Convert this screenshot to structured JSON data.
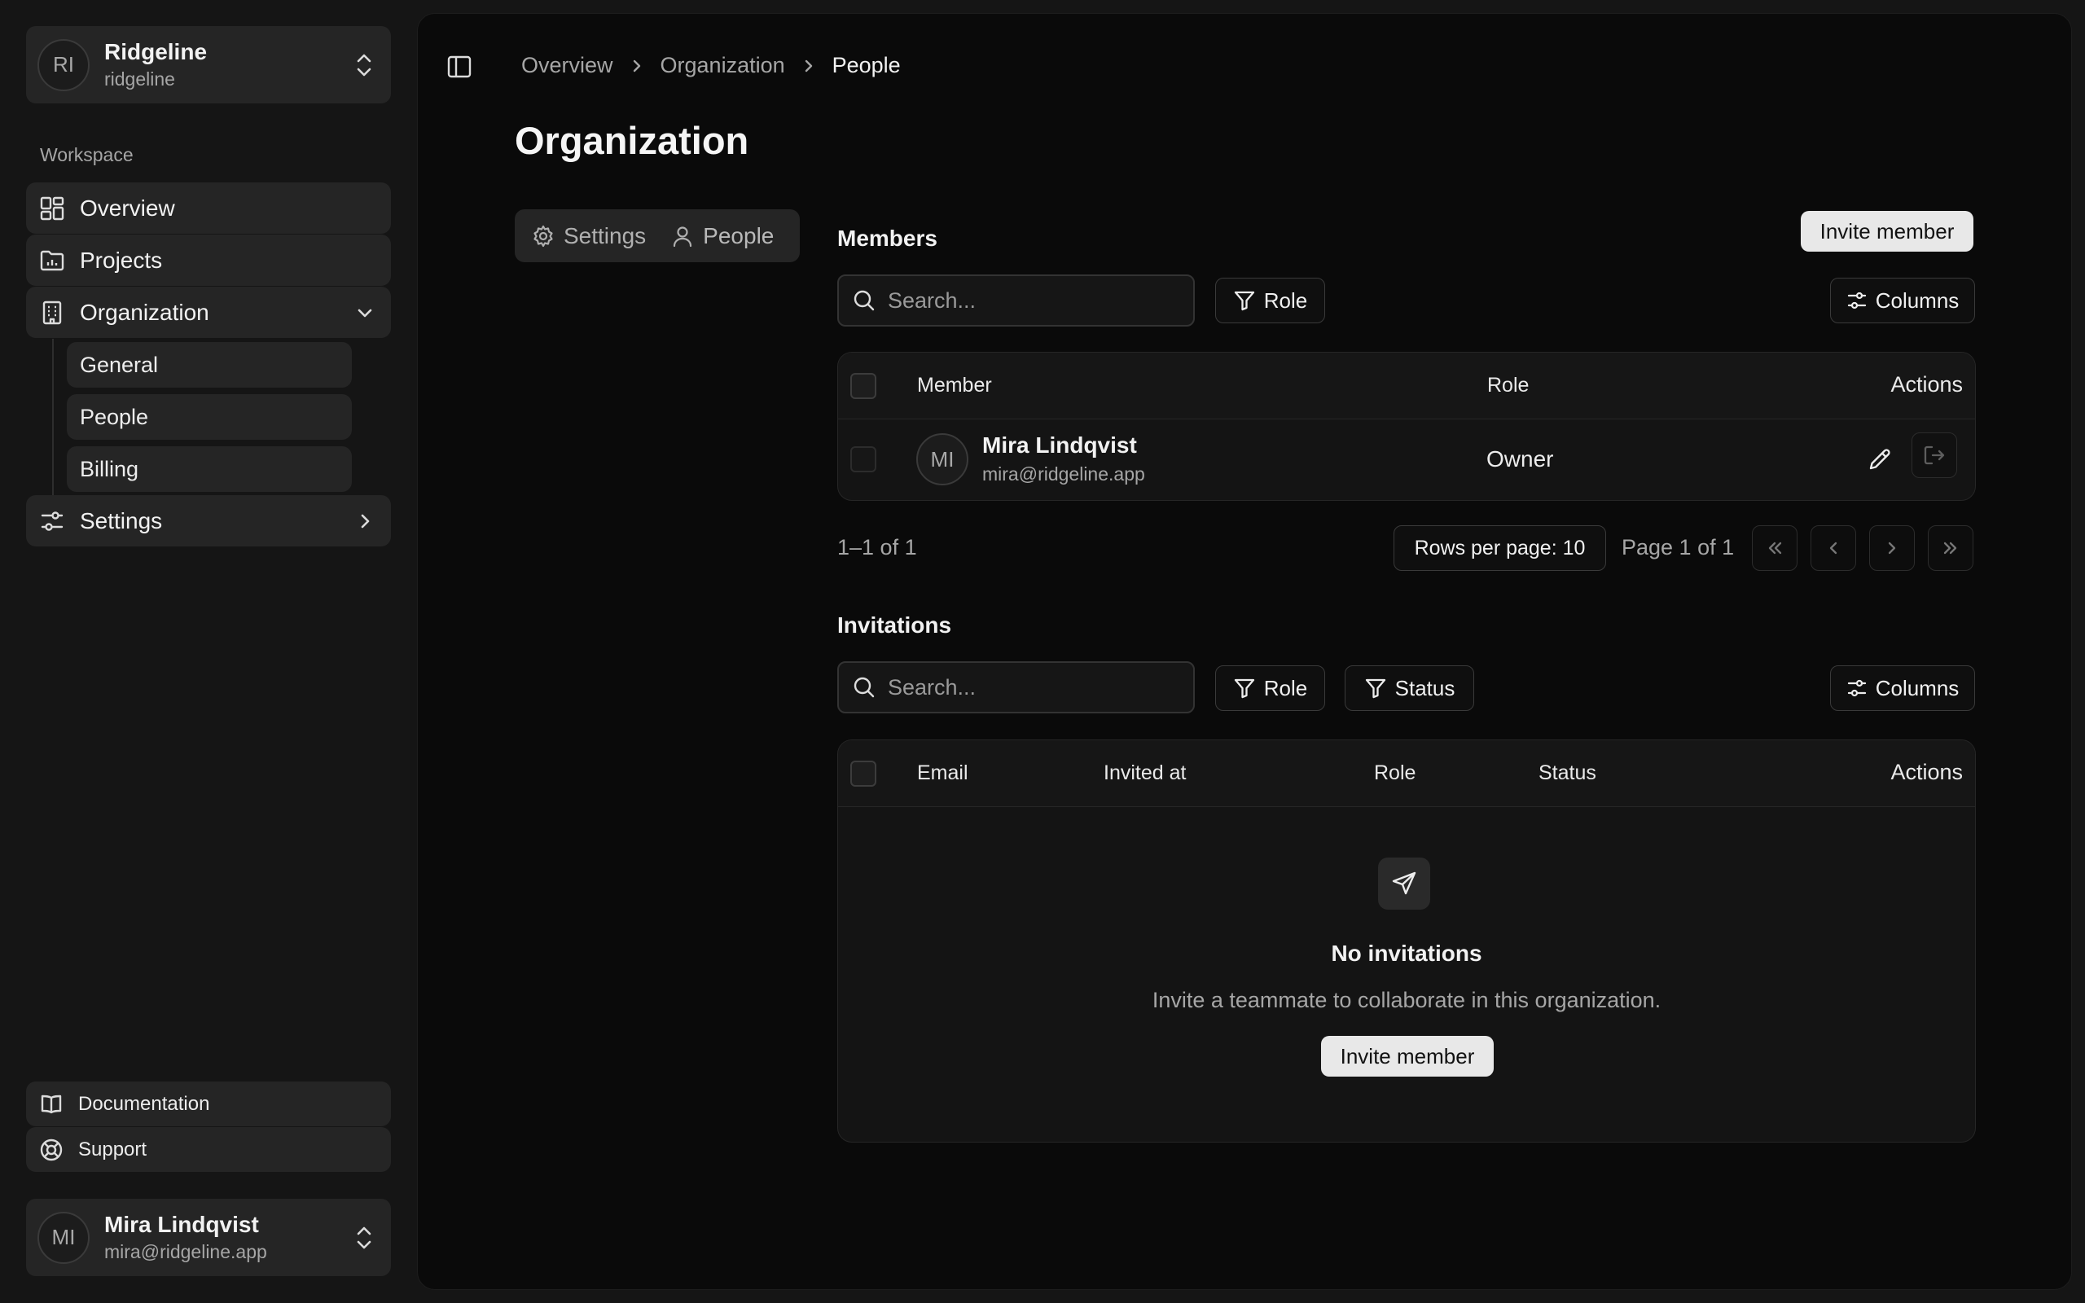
{
  "org": {
    "initials": "RI",
    "name": "Ridgeline",
    "slug": "ridgeline"
  },
  "sidebar": {
    "section_label": "Workspace",
    "items": [
      {
        "label": "Overview",
        "icon": "dashboard-icon"
      },
      {
        "label": "Projects",
        "icon": "folder-chart-icon"
      },
      {
        "label": "Organization",
        "icon": "building-icon"
      },
      {
        "label": "Settings",
        "icon": "sliders-icon"
      }
    ],
    "org_subitems": [
      "General",
      "People",
      "Billing"
    ],
    "footer": [
      {
        "label": "Documentation",
        "icon": "book-icon"
      },
      {
        "label": "Support",
        "icon": "lifebuoy-icon"
      }
    ]
  },
  "user": {
    "initials": "MI",
    "name": "Mira Lindqvist",
    "email": "mira@ridgeline.app"
  },
  "breadcrumb": [
    "Overview",
    "Organization",
    "People"
  ],
  "page_title": "Organization",
  "tabs": [
    {
      "label": "Settings",
      "icon": "gear-icon"
    },
    {
      "label": "People",
      "icon": "user-icon"
    }
  ],
  "members": {
    "title": "Members",
    "invite_label": "Invite member",
    "search_placeholder": "Search...",
    "role_filter": "Role",
    "columns_label": "Columns",
    "headers": {
      "member": "Member",
      "role": "Role",
      "actions": "Actions"
    },
    "rows": [
      {
        "initials": "MI",
        "name": "Mira Lindqvist",
        "email": "mira@ridgeline.app",
        "role": "Owner"
      }
    ],
    "range": "1–1 of 1",
    "rows_per_page": "Rows per page: 10",
    "page_info": "Page 1 of 1"
  },
  "invitations": {
    "title": "Invitations",
    "search_placeholder": "Search...",
    "role_filter": "Role",
    "status_filter": "Status",
    "columns_label": "Columns",
    "headers": {
      "email": "Email",
      "invited_at": "Invited at",
      "role": "Role",
      "status": "Status",
      "actions": "Actions"
    },
    "empty_title": "No invitations",
    "empty_desc": "Invite a teammate to collaborate in this organization.",
    "invite_label": "Invite member"
  }
}
